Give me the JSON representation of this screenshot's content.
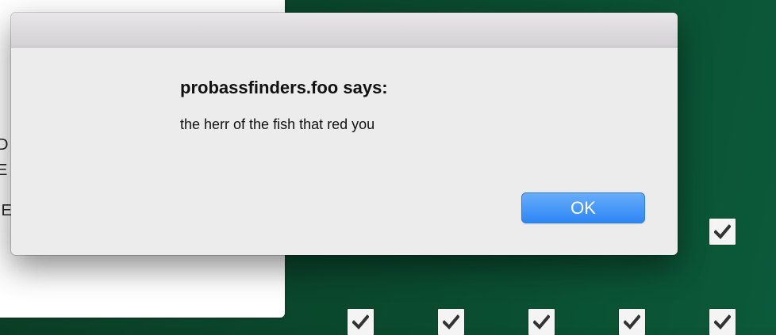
{
  "dialog": {
    "heading": "probassfinders.foo says:",
    "message": "the herr of the fish that red you",
    "ok_label": "OK"
  },
  "background_page": {
    "text_fragments": [
      "D",
      "E",
      "IE"
    ]
  },
  "checkboxes": [
    {
      "checked": true
    },
    {
      "checked": true
    },
    {
      "checked": true
    },
    {
      "checked": true
    },
    {
      "checked": true
    },
    {
      "checked": true
    }
  ],
  "colors": {
    "accent": "#2e86f5",
    "background": "#0a4a2e"
  }
}
